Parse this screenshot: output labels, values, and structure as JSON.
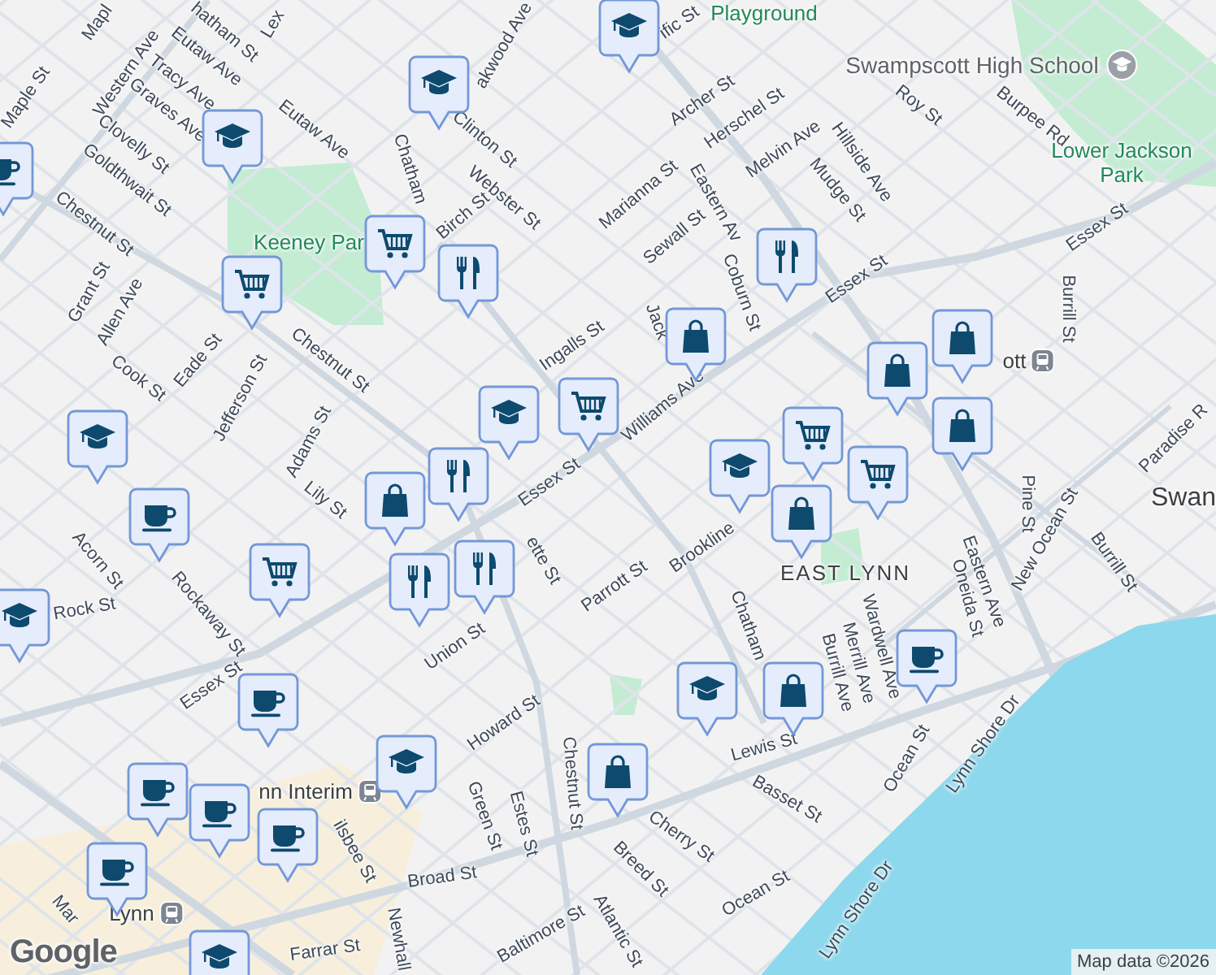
{
  "map": {
    "labels": [
      {
        "text": "Mapl",
        "kind": "street"
      },
      {
        "text": "Western Ave",
        "kind": "street"
      },
      {
        "text": "hatham St",
        "kind": "street"
      },
      {
        "text": "Lex",
        "kind": "street"
      },
      {
        "text": "Eutaw Ave",
        "kind": "street"
      },
      {
        "text": "Tracy Ave",
        "kind": "street"
      },
      {
        "text": "Graves Ave",
        "kind": "street"
      },
      {
        "text": "Eutaw Ave",
        "kind": "street"
      },
      {
        "text": "Clovelly St",
        "kind": "street"
      },
      {
        "text": "Goldthwait St",
        "kind": "street"
      },
      {
        "text": "Maple St",
        "kind": "street"
      },
      {
        "text": "Chestnut St",
        "kind": "street"
      },
      {
        "text": "Grant St",
        "kind": "street"
      },
      {
        "text": "Allen Ave",
        "kind": "street"
      },
      {
        "text": "Keeney Par",
        "kind": "park"
      },
      {
        "text": "Chestnut St",
        "kind": "street"
      },
      {
        "text": "Cook St",
        "kind": "street"
      },
      {
        "text": "Eade St",
        "kind": "street"
      },
      {
        "text": "Jefferson St",
        "kind": "street"
      },
      {
        "text": "Adams St",
        "kind": "street"
      },
      {
        "text": "Lily St",
        "kind": "street"
      },
      {
        "text": "Chatham",
        "kind": "street"
      },
      {
        "text": "akwood Ave",
        "kind": "street"
      },
      {
        "text": "Clinton St",
        "kind": "street"
      },
      {
        "text": "Webster St",
        "kind": "street"
      },
      {
        "text": "Birch St",
        "kind": "street"
      },
      {
        "text": "Marianna St",
        "kind": "street"
      },
      {
        "text": "Sewall St",
        "kind": "street"
      },
      {
        "text": "ific St",
        "kind": "street"
      },
      {
        "text": "Archer St",
        "kind": "street"
      },
      {
        "text": "Herschel St",
        "kind": "street"
      },
      {
        "text": "Melvin Ave",
        "kind": "street"
      },
      {
        "text": "Eastern Av",
        "kind": "street"
      },
      {
        "text": "Coburn St",
        "kind": "street"
      },
      {
        "text": "Ingalls St",
        "kind": "street"
      },
      {
        "text": "Jack",
        "kind": "street"
      },
      {
        "text": "Williams Ave",
        "kind": "street"
      },
      {
        "text": "Essex St",
        "kind": "street"
      },
      {
        "text": "Playground",
        "kind": "park"
      },
      {
        "text": "Swampscott High School",
        "kind": "poi"
      },
      {
        "text": "Roy St",
        "kind": "street"
      },
      {
        "text": "Burpee Rd",
        "kind": "street"
      },
      {
        "text": "Hillside Ave",
        "kind": "street"
      },
      {
        "text": "Mudge St",
        "kind": "street"
      },
      {
        "text": "Lower Jackson Park",
        "kind": "park"
      },
      {
        "text": "Essex St",
        "kind": "street"
      },
      {
        "text": "Essex St",
        "kind": "street"
      },
      {
        "text": "Burrill St",
        "kind": "street"
      },
      {
        "text": "Paradise R",
        "kind": "street"
      },
      {
        "text": "ott",
        "kind": "station"
      },
      {
        "text": "Swan",
        "kind": "area"
      },
      {
        "text": "EAST LYNN",
        "kind": "area"
      },
      {
        "text": "Pine St",
        "kind": "street"
      },
      {
        "text": "New Ocean St",
        "kind": "street"
      },
      {
        "text": "Burrill St",
        "kind": "street"
      },
      {
        "text": "Eastern Ave",
        "kind": "street"
      },
      {
        "text": "Oneida St",
        "kind": "street"
      },
      {
        "text": "Wardwell Ave",
        "kind": "street"
      },
      {
        "text": "Merrill Ave",
        "kind": "street"
      },
      {
        "text": "Burrill Ave",
        "kind": "street"
      },
      {
        "text": "Ocean St",
        "kind": "street"
      },
      {
        "text": "Lynn Shore Dr",
        "kind": "street"
      },
      {
        "text": "Lynn Shore Dr",
        "kind": "street"
      },
      {
        "text": "Brookline",
        "kind": "street"
      },
      {
        "text": "Parrott St",
        "kind": "street"
      },
      {
        "text": "ette St",
        "kind": "street"
      },
      {
        "text": "Union St",
        "kind": "street"
      },
      {
        "text": "Chatham",
        "kind": "street"
      },
      {
        "text": "Howard St",
        "kind": "street"
      },
      {
        "text": "Chestnut St",
        "kind": "street"
      },
      {
        "text": "Lewis St",
        "kind": "street"
      },
      {
        "text": "Basset St",
        "kind": "street"
      },
      {
        "text": "Cherry St",
        "kind": "street"
      },
      {
        "text": "Green St",
        "kind": "street"
      },
      {
        "text": "Estes St",
        "kind": "street"
      },
      {
        "text": "Breed St",
        "kind": "street"
      },
      {
        "text": "Atlantic St",
        "kind": "street"
      },
      {
        "text": "Baltimore St",
        "kind": "street"
      },
      {
        "text": "Ocean St",
        "kind": "street"
      },
      {
        "text": "Broad St",
        "kind": "street"
      },
      {
        "text": "Rockaway St",
        "kind": "street"
      },
      {
        "text": "Acorn St",
        "kind": "street"
      },
      {
        "text": "Rock St",
        "kind": "street"
      },
      {
        "text": "Essex St",
        "kind": "street"
      },
      {
        "text": "nn Interim",
        "kind": "station"
      },
      {
        "text": "ilsbee St",
        "kind": "street"
      },
      {
        "text": "Newhall",
        "kind": "street"
      },
      {
        "text": "Farrar St",
        "kind": "street"
      },
      {
        "text": "Lynn",
        "kind": "station"
      },
      {
        "text": "Mar",
        "kind": "street"
      }
    ],
    "pins": [
      {
        "kind": "school"
      },
      {
        "kind": "school"
      },
      {
        "kind": "school"
      },
      {
        "kind": "school"
      },
      {
        "kind": "school"
      },
      {
        "kind": "school"
      },
      {
        "kind": "school"
      },
      {
        "kind": "school"
      },
      {
        "kind": "school"
      },
      {
        "kind": "school"
      },
      {
        "kind": "grocery"
      },
      {
        "kind": "grocery"
      },
      {
        "kind": "grocery"
      },
      {
        "kind": "grocery"
      },
      {
        "kind": "grocery"
      },
      {
        "kind": "grocery"
      },
      {
        "kind": "restaurant"
      },
      {
        "kind": "restaurant"
      },
      {
        "kind": "restaurant"
      },
      {
        "kind": "restaurant"
      },
      {
        "kind": "restaurant"
      },
      {
        "kind": "shopping"
      },
      {
        "kind": "shopping"
      },
      {
        "kind": "shopping"
      },
      {
        "kind": "shopping"
      },
      {
        "kind": "shopping"
      },
      {
        "kind": "shopping"
      },
      {
        "kind": "shopping"
      },
      {
        "kind": "shopping"
      },
      {
        "kind": "cafe"
      },
      {
        "kind": "cafe"
      },
      {
        "kind": "cafe"
      },
      {
        "kind": "cafe"
      },
      {
        "kind": "cafe"
      },
      {
        "kind": "cafe"
      },
      {
        "kind": "cafe"
      },
      {
        "kind": "cafe"
      }
    ],
    "logo": "Google",
    "attribution": "Map data ©2026"
  }
}
